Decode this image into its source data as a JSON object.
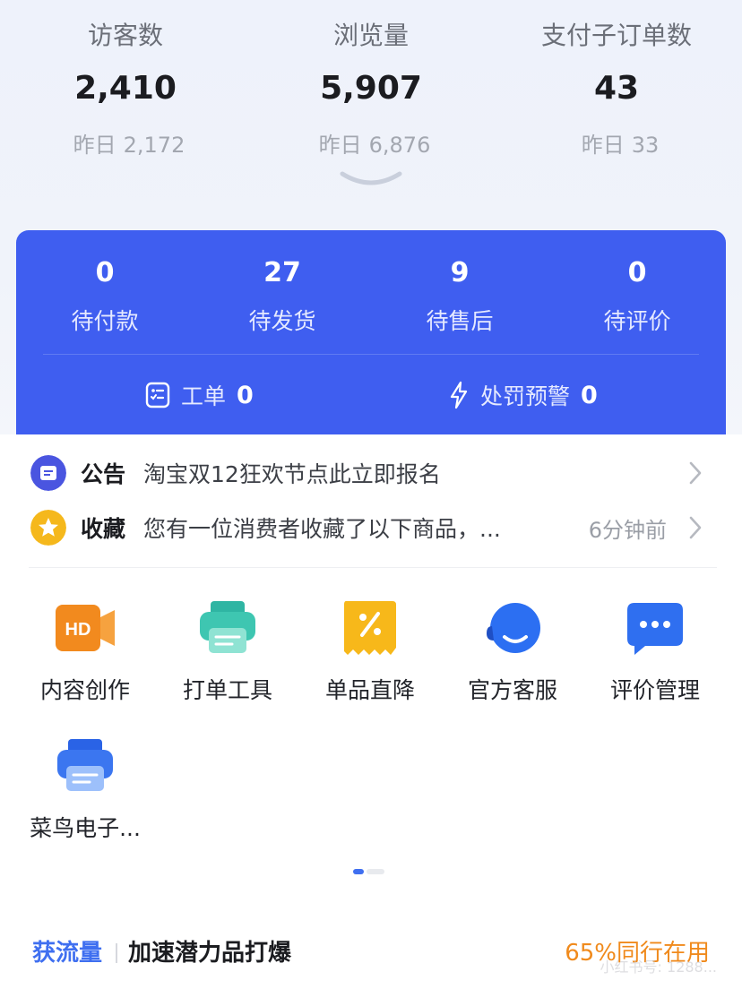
{
  "stats": [
    {
      "label": "访客数",
      "value": "2,410",
      "prev_label": "昨日",
      "prev_value": "2,172"
    },
    {
      "label": "浏览量",
      "value": "5,907",
      "prev_label": "昨日",
      "prev_value": "6,876"
    },
    {
      "label": "支付子订单数",
      "value": "43",
      "prev_label": "昨日",
      "prev_value": "33"
    }
  ],
  "orders": [
    {
      "count": "0",
      "label": "待付款"
    },
    {
      "count": "27",
      "label": "待发货"
    },
    {
      "count": "9",
      "label": "待售后"
    },
    {
      "count": "0",
      "label": "待评价"
    }
  ],
  "card_links": {
    "ticket": {
      "label": "工单",
      "count": "0"
    },
    "penalty": {
      "label": "处罚预警",
      "count": "0"
    }
  },
  "notices": [
    {
      "title": "公告",
      "text": "淘宝双12狂欢节点此立即报名",
      "time": "",
      "icon": "announcement-icon",
      "color": "#4a55e0"
    },
    {
      "title": "收藏",
      "text": "您有一位消费者收藏了以下商品，...",
      "time": "6分钟前",
      "icon": "star-icon",
      "color": "#f5b81c"
    }
  ],
  "tools": [
    {
      "name": "内容创作",
      "icon": "hd-video-icon"
    },
    {
      "name": "打单工具",
      "icon": "printer-icon"
    },
    {
      "name": "单品直降",
      "icon": "discount-icon"
    },
    {
      "name": "官方客服",
      "icon": "customer-service-icon"
    },
    {
      "name": "评价管理",
      "icon": "chat-bubble-icon"
    },
    {
      "name": "菜鸟电子...",
      "icon": "printer-blue-icon"
    }
  ],
  "pager": {
    "current": 1,
    "total": 2
  },
  "promo": {
    "tag": "获流量",
    "title": "加速潜力品打爆",
    "stat": "65%同行在用"
  },
  "watermark": "小红书号: 1288..."
}
